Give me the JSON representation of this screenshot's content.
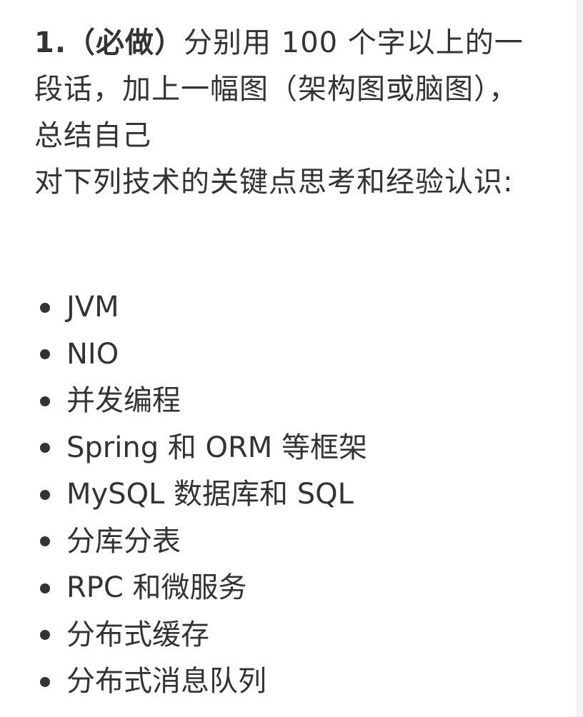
{
  "heading": {
    "bold_prefix": "1.（必做）",
    "rest": "分别用 100 个字以上的一段话，加上一幅图（架构图或脑图），总结自己"
  },
  "body_text": "对下列技术的关键点思考和经验认识:",
  "topics": [
    "JVM",
    "NIO",
    "并发编程",
    "Spring 和 ORM 等框架",
    "MySQL 数据库和 SQL",
    "分库分表",
    "RPC 和微服务",
    "分布式缓存",
    "分布式消息队列"
  ]
}
